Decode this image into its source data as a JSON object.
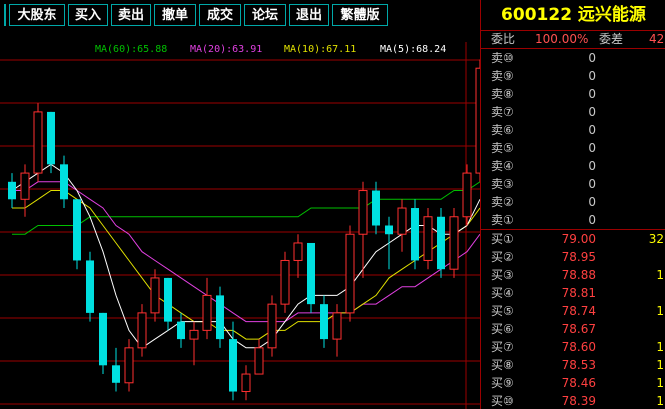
{
  "toolbar": {
    "buttons": [
      "大股东",
      "买入",
      "卖出",
      "撤单",
      "成交",
      "论坛",
      "退出",
      "繁體版"
    ]
  },
  "ma_legend": [
    {
      "label": "MA(60):65.88",
      "color": "#00c000"
    },
    {
      "label": "MA(20):63.91",
      "color": "#e040e0"
    },
    {
      "label": "MA(10):67.11",
      "color": "#e0e000"
    },
    {
      "label": "MA(5):68.24",
      "color": "#ffffff"
    }
  ],
  "stock": {
    "title": "600122 远兴能源"
  },
  "weibi": {
    "label1": "委比",
    "value1": "100.00%",
    "label2": "委差",
    "value2": "42"
  },
  "sell_rows": [
    {
      "label": "卖⑩",
      "price": "0",
      "vol": ""
    },
    {
      "label": "卖⑨",
      "price": "0",
      "vol": ""
    },
    {
      "label": "卖⑧",
      "price": "0",
      "vol": ""
    },
    {
      "label": "卖⑦",
      "price": "0",
      "vol": ""
    },
    {
      "label": "卖⑥",
      "price": "0",
      "vol": ""
    },
    {
      "label": "卖⑤",
      "price": "0",
      "vol": ""
    },
    {
      "label": "卖④",
      "price": "0",
      "vol": ""
    },
    {
      "label": "卖③",
      "price": "0",
      "vol": ""
    },
    {
      "label": "卖②",
      "price": "0",
      "vol": ""
    },
    {
      "label": "卖①",
      "price": "0",
      "vol": ""
    }
  ],
  "buy_rows": [
    {
      "label": "买①",
      "price": "79.00",
      "vol": "32"
    },
    {
      "label": "买②",
      "price": "78.95",
      "vol": ""
    },
    {
      "label": "买③",
      "price": "78.88",
      "vol": "1"
    },
    {
      "label": "买④",
      "price": "78.81",
      "vol": ""
    },
    {
      "label": "买⑤",
      "price": "78.74",
      "vol": "1"
    },
    {
      "label": "买⑥",
      "price": "78.67",
      "vol": ""
    },
    {
      "label": "买⑦",
      "price": "78.60",
      "vol": "1"
    },
    {
      "label": "买⑧",
      "price": "78.53",
      "vol": "1"
    },
    {
      "label": "买⑨",
      "price": "78.46",
      "vol": "1"
    },
    {
      "label": "买⑩",
      "price": "78.39",
      "vol": "1"
    }
  ],
  "colors": {
    "up": "#ff3030",
    "down": "#00e0e0",
    "grid": "#9b0000",
    "title": "#ffff00"
  },
  "chart_data": {
    "type": "candlestick",
    "candles": [
      {
        "o": 66,
        "h": 67,
        "l": 63,
        "c": 64
      },
      {
        "o": 64,
        "h": 68,
        "l": 62,
        "c": 67
      },
      {
        "o": 67,
        "h": 75,
        "l": 66,
        "c": 74
      },
      {
        "o": 74,
        "h": 74,
        "l": 67,
        "c": 68
      },
      {
        "o": 68,
        "h": 69,
        "l": 63,
        "c": 64
      },
      {
        "o": 64,
        "h": 64,
        "l": 56,
        "c": 57
      },
      {
        "o": 57,
        "h": 58,
        "l": 50,
        "c": 51
      },
      {
        "o": 51,
        "h": 51,
        "l": 44,
        "c": 45
      },
      {
        "o": 45,
        "h": 47,
        "l": 42,
        "c": 43
      },
      {
        "o": 43,
        "h": 48,
        "l": 42,
        "c": 47
      },
      {
        "o": 47,
        "h": 52,
        "l": 46,
        "c": 51
      },
      {
        "o": 51,
        "h": 56,
        "l": 50,
        "c": 55
      },
      {
        "o": 55,
        "h": 55,
        "l": 49,
        "c": 50
      },
      {
        "o": 50,
        "h": 51,
        "l": 47,
        "c": 48
      },
      {
        "o": 48,
        "h": 50,
        "l": 45,
        "c": 49
      },
      {
        "o": 49,
        "h": 55,
        "l": 48,
        "c": 53
      },
      {
        "o": 53,
        "h": 54,
        "l": 47,
        "c": 48
      },
      {
        "o": 48,
        "h": 50,
        "l": 41,
        "c": 42
      },
      {
        "o": 42,
        "h": 45,
        "l": 41,
        "c": 44
      },
      {
        "o": 44,
        "h": 48,
        "l": 44,
        "c": 47
      },
      {
        "o": 47,
        "h": 53,
        "l": 46,
        "c": 52
      },
      {
        "o": 52,
        "h": 58,
        "l": 51,
        "c": 57
      },
      {
        "o": 57,
        "h": 60,
        "l": 55,
        "c": 59
      },
      {
        "o": 59,
        "h": 59,
        "l": 51,
        "c": 52
      },
      {
        "o": 52,
        "h": 53,
        "l": 47,
        "c": 48
      },
      {
        "o": 48,
        "h": 52,
        "l": 46,
        "c": 51
      },
      {
        "o": 51,
        "h": 61,
        "l": 50,
        "c": 60
      },
      {
        "o": 60,
        "h": 66,
        "l": 55,
        "c": 65
      },
      {
        "o": 65,
        "h": 66,
        "l": 60,
        "c": 61
      },
      {
        "o": 61,
        "h": 62,
        "l": 56,
        "c": 60
      },
      {
        "o": 60,
        "h": 64,
        "l": 58,
        "c": 63
      },
      {
        "o": 63,
        "h": 64,
        "l": 56,
        "c": 57
      },
      {
        "o": 57,
        "h": 63,
        "l": 56,
        "c": 62
      },
      {
        "o": 62,
        "h": 63,
        "l": 55,
        "c": 56
      },
      {
        "o": 56,
        "h": 63,
        "l": 55,
        "c": 62
      },
      {
        "o": 62,
        "h": 68,
        "l": 61,
        "c": 67
      },
      {
        "o": 67,
        "h": 80,
        "l": 66,
        "c": 79
      }
    ],
    "ma5": [
      65,
      66,
      67,
      68,
      67,
      65,
      62,
      58,
      53,
      49,
      47,
      48,
      49,
      50,
      50,
      50,
      50,
      48,
      47,
      47,
      48,
      50,
      52,
      53,
      53,
      53,
      54,
      56,
      58,
      59,
      60,
      61,
      61,
      60,
      60,
      61,
      64
    ],
    "ma10": [
      63,
      63,
      64,
      65,
      65,
      64,
      63,
      61,
      59,
      57,
      55,
      53,
      52,
      51,
      50,
      50,
      49,
      49,
      48,
      48,
      49,
      49,
      50,
      50,
      50,
      51,
      51,
      52,
      53,
      55,
      56,
      57,
      58,
      59,
      60,
      61,
      63
    ],
    "ma20": [
      65,
      65,
      66,
      66,
      66,
      65,
      64,
      63,
      61,
      60,
      58,
      57,
      56,
      55,
      54,
      53,
      52,
      51,
      50,
      50,
      50,
      50,
      51,
      51,
      51,
      51,
      51,
      52,
      52,
      53,
      54,
      54,
      55,
      56,
      57,
      58,
      60
    ],
    "ma60": [
      60,
      60,
      61,
      61,
      61,
      61,
      62,
      62,
      62,
      62,
      62,
      62,
      62,
      62,
      62,
      62,
      62,
      62,
      62,
      62,
      62,
      62,
      62,
      63,
      63,
      63,
      63,
      63,
      64,
      64,
      64,
      64,
      64,
      64,
      65,
      65,
      66
    ],
    "ylim": [
      40,
      82
    ]
  }
}
